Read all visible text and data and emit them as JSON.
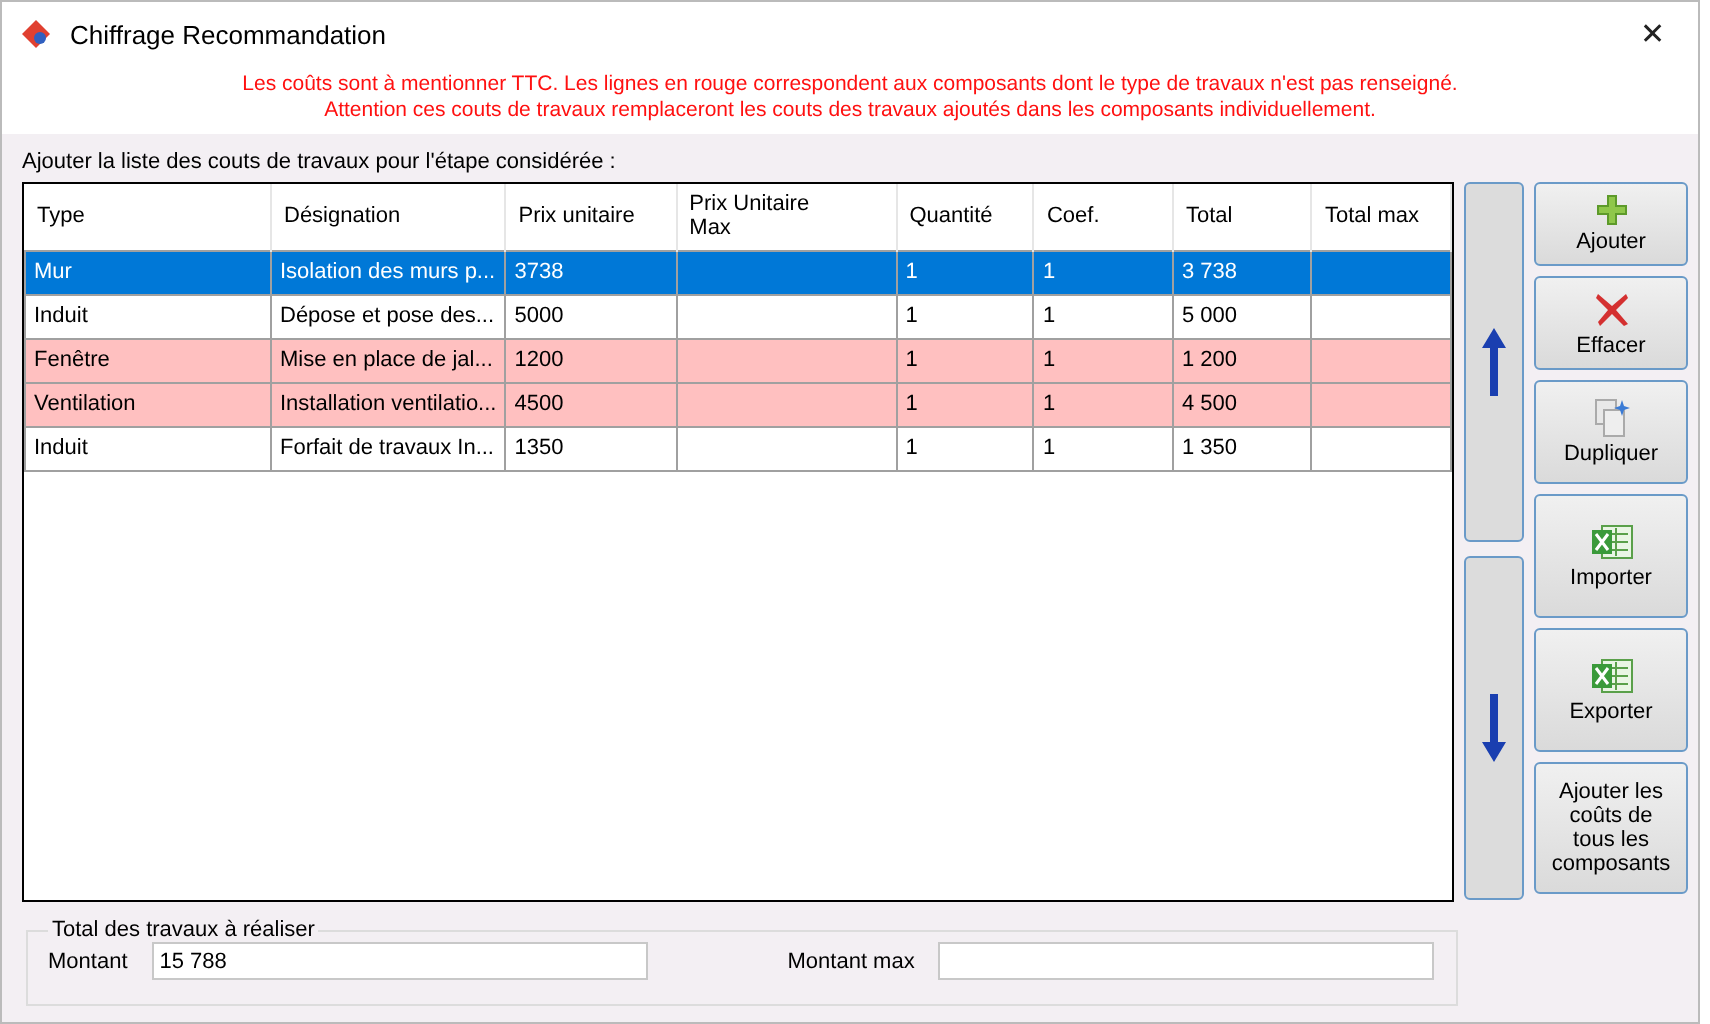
{
  "window": {
    "title": "Chiffrage Recommandation",
    "close": "✕"
  },
  "warnings": [
    "Les coûts sont à mentionner TTC. Les lignes en rouge correspondent aux composants dont le type de travaux n'est pas renseigné.",
    "Attention ces couts de travaux remplaceront les couts des travaux ajoutés dans les composants individuellement."
  ],
  "list_label": "Ajouter la liste des couts de travaux pour l'étape considérée :",
  "table": {
    "columns": [
      "Type",
      "Désignation",
      "Prix unitaire",
      "Prix Unitaire Max",
      "Quantité",
      "Coef.",
      "Total",
      "Total max"
    ],
    "rows": [
      {
        "selected": true,
        "missing_type": false,
        "cells": [
          "Mur",
          "Isolation des murs p...",
          "3738",
          null,
          "1",
          "1",
          "3 738",
          null
        ]
      },
      {
        "selected": false,
        "missing_type": false,
        "cells": [
          "Induit",
          "Dépose et pose des...",
          "5000",
          null,
          "1",
          "1",
          "5 000",
          null
        ]
      },
      {
        "selected": false,
        "missing_type": true,
        "cells": [
          "Fenêtre",
          "Mise en place de jal...",
          "1200",
          null,
          "1",
          "1",
          "1 200",
          null
        ]
      },
      {
        "selected": false,
        "missing_type": true,
        "cells": [
          "Ventilation",
          "Installation ventilatio...",
          "4500",
          null,
          "1",
          "1",
          "4 500",
          null
        ]
      },
      {
        "selected": false,
        "missing_type": false,
        "cells": [
          "Induit",
          "Forfait de travaux In...",
          "1350",
          null,
          "1",
          "1",
          "1 350",
          null
        ]
      }
    ]
  },
  "actions": [
    {
      "kind": "add",
      "label": "Ajouter"
    },
    {
      "kind": "delete",
      "label": "Effacer"
    },
    {
      "kind": "duplicate",
      "label": "Dupliquer"
    },
    {
      "kind": "excel",
      "label": "Importer"
    },
    {
      "kind": "excel",
      "label": "Exporter"
    },
    {
      "kind": "text",
      "label": "Ajouter les coûts de tous les composants"
    }
  ],
  "totals": {
    "title": "Total des travaux à réaliser",
    "fields": [
      {
        "label": "Montant",
        "value": "15 788"
      },
      {
        "label": "Montant max"
      }
    ]
  }
}
